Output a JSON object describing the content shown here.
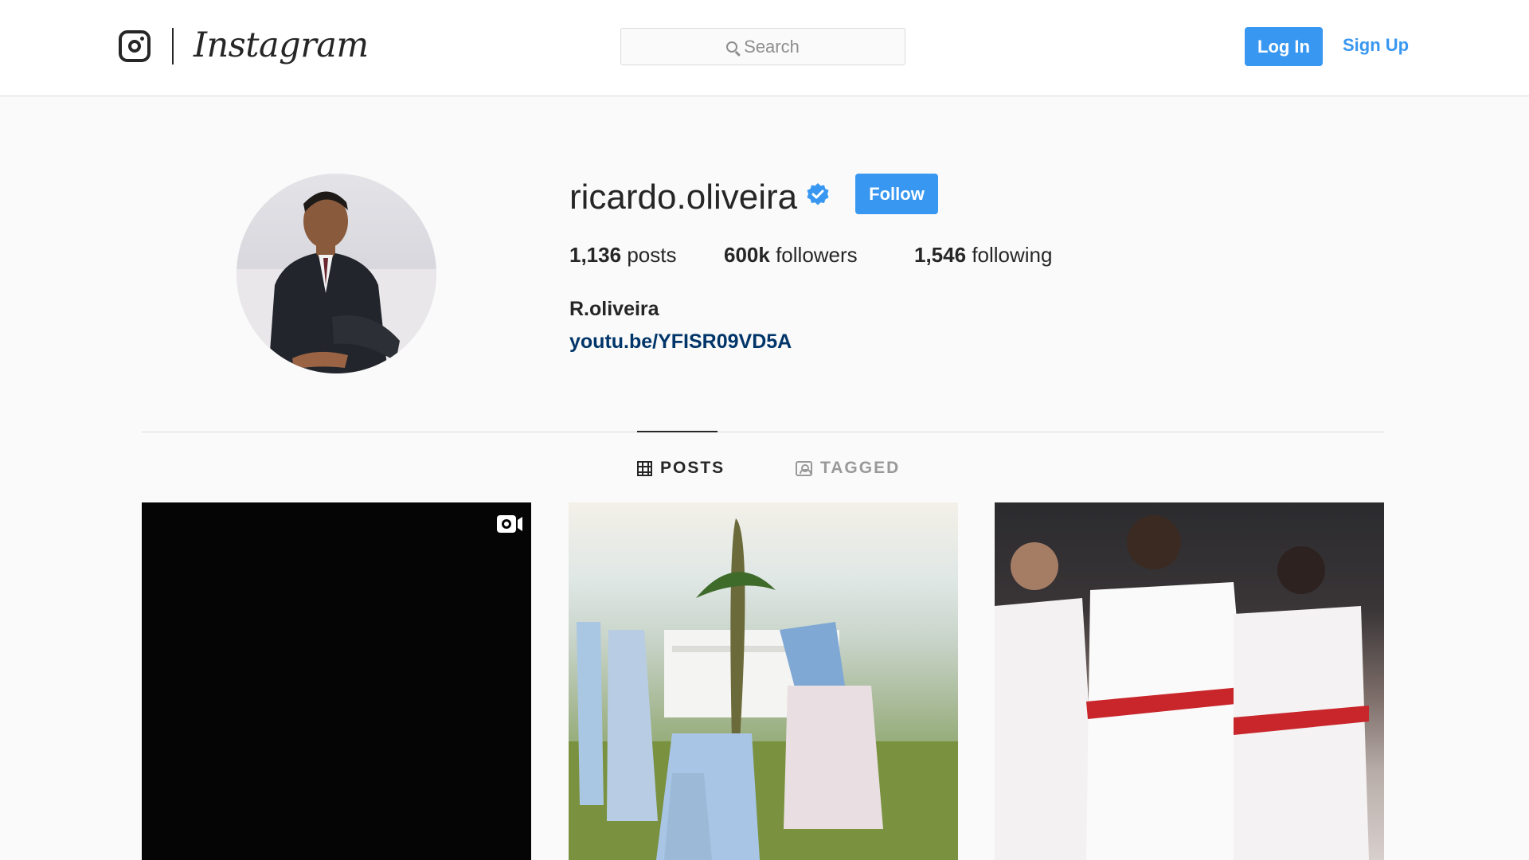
{
  "header": {
    "logo_icon": "instagram-camera-icon",
    "wordmark": "Instagram",
    "search_placeholder": "Search",
    "login_label": "Log In",
    "signup_label": "Sign Up"
  },
  "profile": {
    "username": "ricardo.oliveira",
    "verified_icon": "verified-badge-icon",
    "follow_label": "Follow",
    "stats": {
      "posts_count": "1,136",
      "posts_label": "posts",
      "followers_count": "600k",
      "followers_label": "followers",
      "following_count": "1,546",
      "following_label": "following"
    },
    "full_name": "R.oliveira",
    "bio_link": "youtu.be/YFISR09VD5A"
  },
  "tabs": [
    {
      "label": "POSTS",
      "icon": "grid-icon",
      "active": true
    },
    {
      "label": "TAGGED",
      "icon": "tagged-icon",
      "active": false
    }
  ],
  "posts": [
    {
      "kind": "video",
      "badge_icon": "igtv-icon"
    },
    {
      "kind": "photo"
    },
    {
      "kind": "photo"
    }
  ],
  "colors": {
    "accent": "#3897f0",
    "link": "#003569",
    "text": "#262626",
    "muted": "#999999",
    "background": "#fafafa"
  }
}
